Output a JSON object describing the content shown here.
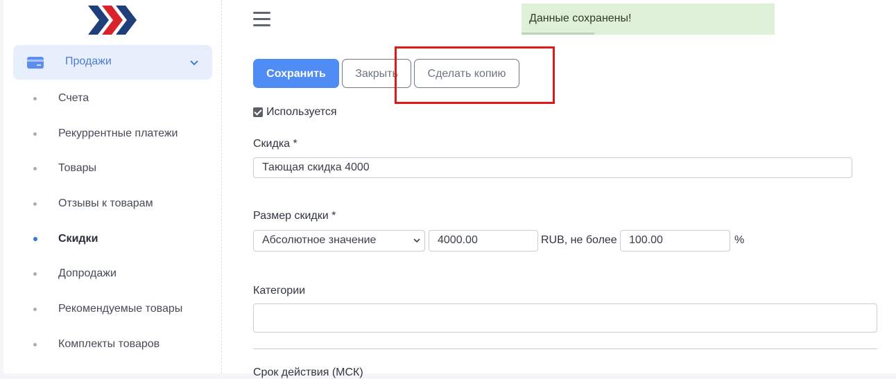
{
  "sidebar": {
    "logo_icon": "brand-chevrons-logo",
    "group": {
      "label": "Продажи",
      "icon": "credit-card-icon",
      "expanded": true
    },
    "items": [
      {
        "label": "Счета",
        "active": false
      },
      {
        "label": "Рекуррентные платежи",
        "active": false
      },
      {
        "label": "Товары",
        "active": false
      },
      {
        "label": "Отзывы к товарам",
        "active": false
      },
      {
        "label": "Скидки",
        "active": true
      },
      {
        "label": "Допродажи",
        "active": false
      },
      {
        "label": "Рекомендуемые товары",
        "active": false
      },
      {
        "label": "Комплекты товаров",
        "active": false
      }
    ]
  },
  "toast": {
    "message": "Данные сохранены!"
  },
  "toolbar": {
    "save_label": "Сохранить",
    "close_label": "Закрыть",
    "copy_label": "Сделать копию"
  },
  "form": {
    "enabled_label": "Используется",
    "enabled": true,
    "discount_label": "Скидка *",
    "discount_value": "Тающая скидка 4000",
    "size_label": "Размер скидки *",
    "size_type": "Абсолютное значение",
    "amount": "4000.00",
    "currency_text": "RUB, не более",
    "max_percent": "100.00",
    "percent_sign": "%",
    "categories_label": "Категории",
    "categories_value": "",
    "validity_label": "Срок действия (МСК)"
  },
  "colors": {
    "accent": "#4f8cf5",
    "active_menu_bg": "#e8effc",
    "toast_bg": "#dff0d8",
    "highlight": "#e01818"
  }
}
